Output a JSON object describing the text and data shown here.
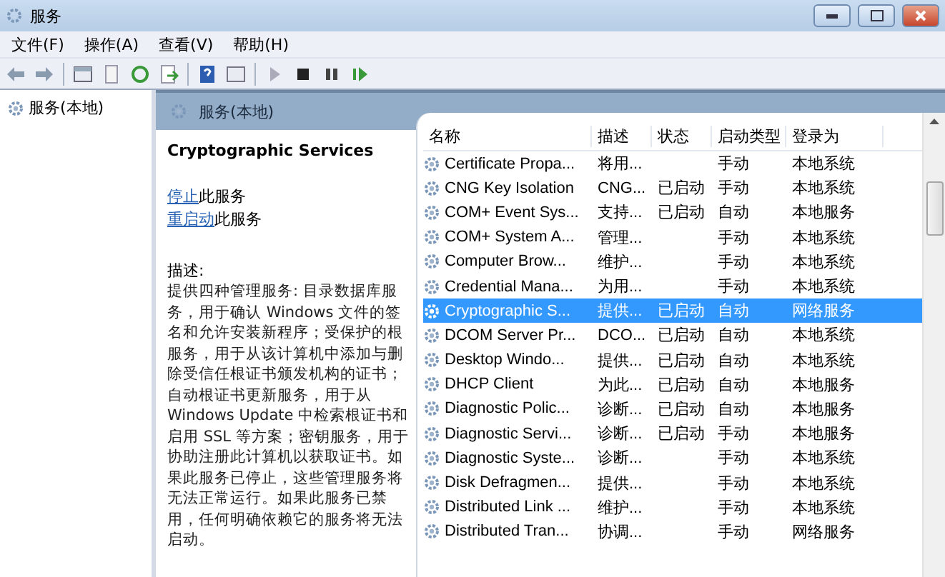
{
  "window": {
    "title": "服务"
  },
  "menu": [
    "文件(F)",
    "操作(A)",
    "查看(V)",
    "帮助(H)"
  ],
  "tree": {
    "items": [
      {
        "label": "服务(本地)",
        "selected": false
      }
    ]
  },
  "pane_header": "服务(本地)",
  "details": {
    "service_name": "Cryptographic Services",
    "actions": [
      {
        "link": "停止",
        "text": "此服务"
      },
      {
        "link": "重启动",
        "text": "此服务"
      }
    ],
    "description_label": "描述:",
    "description": "提供四种管理服务: 目录数据库服务，用于确认 Windows 文件的签名和允许安装新程序；受保护的根服务，用于从该计算机中添加与删除受信任根证书颁发机构的证书；自动根证书更新服务，用于从 Windows Update 中检索根证书和启用 SSL 等方案；密钥服务，用于协助注册此计算机以获取证书。如果此服务已停止，这些管理服务将无法正常运行。如果此服务已禁用，任何明确依赖它的服务将无法启动。"
  },
  "table": {
    "columns": [
      "名称",
      "描述",
      "状态",
      "启动类型",
      "登录为"
    ],
    "rows": [
      {
        "name": "Certificate Propa...",
        "description": "将用...",
        "status": "",
        "startup": "手动",
        "logon": "本地系统",
        "selected": false
      },
      {
        "name": "CNG Key Isolation",
        "description": "CNG...",
        "status": "已启动",
        "startup": "手动",
        "logon": "本地系统",
        "selected": false
      },
      {
        "name": "COM+ Event Sys...",
        "description": "支持...",
        "status": "已启动",
        "startup": "自动",
        "logon": "本地服务",
        "selected": false
      },
      {
        "name": "COM+ System A...",
        "description": "管理...",
        "status": "",
        "startup": "手动",
        "logon": "本地系统",
        "selected": false
      },
      {
        "name": "Computer Brow...",
        "description": "维护...",
        "status": "",
        "startup": "手动",
        "logon": "本地系统",
        "selected": false
      },
      {
        "name": "Credential Mana...",
        "description": "为用...",
        "status": "",
        "startup": "手动",
        "logon": "本地系统",
        "selected": false
      },
      {
        "name": "Cryptographic S...",
        "description": "提供...",
        "status": "已启动",
        "startup": "自动",
        "logon": "网络服务",
        "selected": true
      },
      {
        "name": "DCOM Server Pr...",
        "description": "DCO...",
        "status": "已启动",
        "startup": "自动",
        "logon": "本地系统",
        "selected": false
      },
      {
        "name": "Desktop Windo...",
        "description": "提供...",
        "status": "已启动",
        "startup": "自动",
        "logon": "本地系统",
        "selected": false
      },
      {
        "name": "DHCP Client",
        "description": "为此...",
        "status": "已启动",
        "startup": "自动",
        "logon": "本地服务",
        "selected": false
      },
      {
        "name": "Diagnostic Polic...",
        "description": "诊断...",
        "status": "已启动",
        "startup": "自动",
        "logon": "本地服务",
        "selected": false
      },
      {
        "name": "Diagnostic Servi...",
        "description": "诊断...",
        "status": "已启动",
        "startup": "手动",
        "logon": "本地服务",
        "selected": false
      },
      {
        "name": "Diagnostic Syste...",
        "description": "诊断...",
        "status": "",
        "startup": "手动",
        "logon": "本地系统",
        "selected": false
      },
      {
        "name": "Disk Defragmen...",
        "description": "提供...",
        "status": "",
        "startup": "手动",
        "logon": "本地系统",
        "selected": false
      },
      {
        "name": "Distributed Link ...",
        "description": "维护...",
        "status": "",
        "startup": "手动",
        "logon": "本地系统",
        "selected": false
      },
      {
        "name": "Distributed Tran...",
        "description": "协调...",
        "status": "",
        "startup": "手动",
        "logon": "网络服务",
        "selected": false
      }
    ]
  }
}
